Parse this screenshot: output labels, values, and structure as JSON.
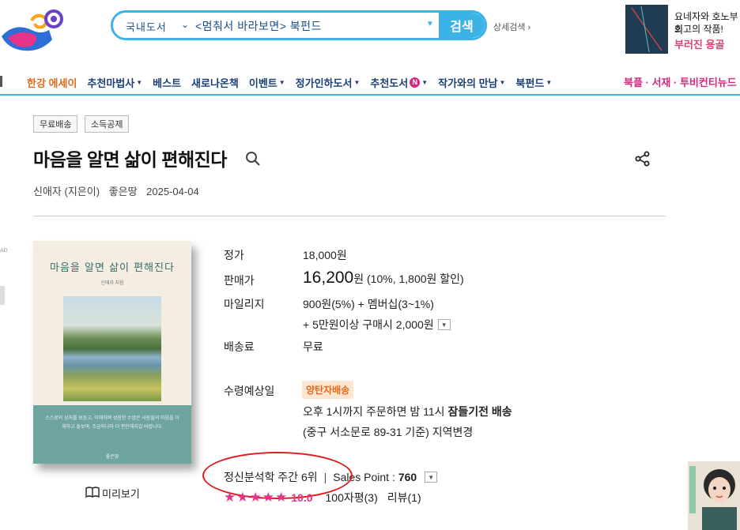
{
  "header": {
    "logo_icon": "genie-lamp-logo-icon",
    "search": {
      "category": "국내도서",
      "query": "<멈춰서 바라보면> 북펀드",
      "button": "검색",
      "advanced": "상세검색 ›"
    },
    "ad": {
      "line1": "요네자와 호노부의",
      "line2": "최고의 작품!",
      "line3": "부러진 용골"
    }
  },
  "nav": {
    "items": [
      {
        "label": "한강 에세이",
        "dropdown": false,
        "badge": "",
        "highlight": true
      },
      {
        "label": "추천마법사",
        "dropdown": true,
        "badge": ""
      },
      {
        "label": "베스트",
        "dropdown": false,
        "badge": ""
      },
      {
        "label": "새로나온책",
        "dropdown": false,
        "badge": ""
      },
      {
        "label": "이벤트",
        "dropdown": true,
        "badge": ""
      },
      {
        "label": "정가인하도서",
        "dropdown": true,
        "badge": ""
      },
      {
        "label": "추천도서",
        "dropdown": true,
        "badge": "N"
      },
      {
        "label": "작가와의 만남",
        "dropdown": true,
        "badge": ""
      },
      {
        "label": "북펀드",
        "dropdown": true,
        "badge": ""
      }
    ],
    "right": "북플 · 서재 · 투비컨티뉴드"
  },
  "product": {
    "tags": [
      "무료배송",
      "소득공제"
    ],
    "title": "마음을 알면 삶이 편해진다",
    "author": "신애자 (지은이)",
    "publisher": "좋은땅",
    "date": "2025-04-04",
    "cover": {
      "title": "마음을 알면 삶이 편해진다",
      "author": "신애자 지음",
      "blurb": "스스로의 상처를 보듬고, 이해하며 성장한 수많은 사람들의 마음을 이해하고 돌보며, 조금이나마 더 편안해지길 바랍니다.",
      "publisher": "좋은땅"
    },
    "preview": "미리보기"
  },
  "price": {
    "list_label": "정가",
    "list_value": "18,000원",
    "sale_label": "판매가",
    "sale_value": "16,200",
    "sale_unit": "원",
    "sale_note": "(10%, 1,800원 할인)",
    "mileage_label": "마일리지",
    "mileage_value": "900원(5%) + 멤버십(3~1%)",
    "mileage_extra": "+ 5만원이상 구매시 2,000원",
    "ship_label": "배송료",
    "ship_value": "무료",
    "recv_label": "수령예상일",
    "recv_badge": "양탄자배송",
    "recv_line1_pre": "오후 1시까지 주문하면 밤 11시 ",
    "recv_line1_bold": "잠들기전 배송",
    "recv_line2": "(중구 서소문로 89-31 기준) 지역변경"
  },
  "rank": {
    "text": "정신분석학 주간 6위",
    "sep": "|",
    "sales_label": "Sales Point :",
    "sales_value": "760"
  },
  "rating": {
    "stars": 5,
    "score": "10.0",
    "review100": "100자평(3)",
    "reviews": "리뷰(1)"
  },
  "colors": {
    "accent": "#3bb3e6",
    "nav": "#1a3f76",
    "pink": "#e8338a",
    "orange": "#e36a1a",
    "circle": "#e01a1a"
  }
}
